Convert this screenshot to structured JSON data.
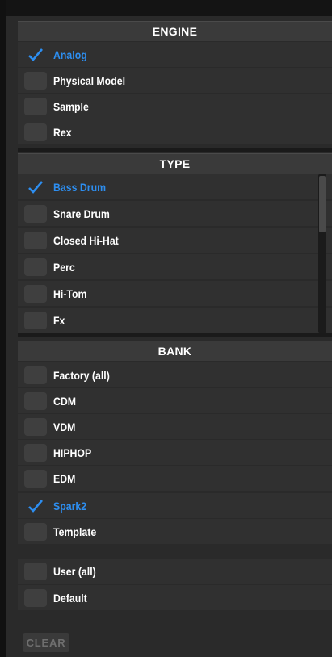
{
  "sections": {
    "engine": {
      "title": "ENGINE",
      "items": [
        {
          "label": "Analog",
          "checked": true
        },
        {
          "label": "Physical Model",
          "checked": false
        },
        {
          "label": "Sample",
          "checked": false
        },
        {
          "label": "Rex",
          "checked": false
        }
      ]
    },
    "type": {
      "title": "TYPE",
      "items": [
        {
          "label": "Bass Drum",
          "checked": true
        },
        {
          "label": "Snare Drum",
          "checked": false
        },
        {
          "label": "Closed Hi-Hat",
          "checked": false
        },
        {
          "label": "Perc",
          "checked": false
        },
        {
          "label": "Hi-Tom",
          "checked": false
        },
        {
          "label": "Fx",
          "checked": false
        }
      ]
    },
    "bank": {
      "title": "BANK",
      "items": [
        {
          "label": "Factory (all)",
          "checked": false
        },
        {
          "label": "CDM",
          "checked": false
        },
        {
          "label": "VDM",
          "checked": false
        },
        {
          "label": "HIPHOP",
          "checked": false
        },
        {
          "label": "EDM",
          "checked": false
        },
        {
          "label": "Spark2",
          "checked": true
        },
        {
          "label": "Template",
          "checked": false
        }
      ],
      "user_items": [
        {
          "label": "User (all)",
          "checked": false
        },
        {
          "label": "Default",
          "checked": false
        }
      ]
    }
  },
  "clear_label": "CLEAR",
  "colors": {
    "accent": "#2d8ef0",
    "background": "#2a2a2a",
    "header": "#3a3a3a"
  },
  "icons": {
    "check": "checkmark-icon"
  }
}
